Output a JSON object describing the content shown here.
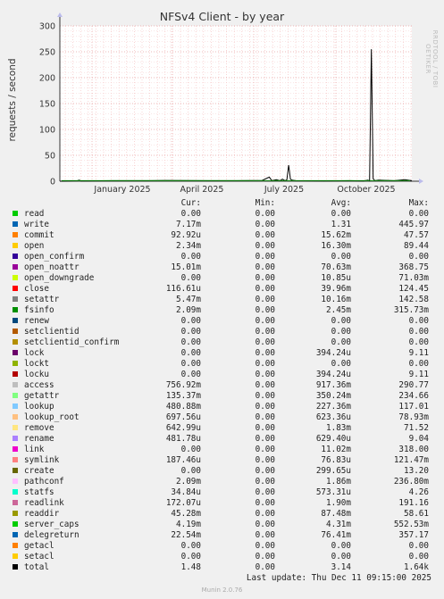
{
  "chart_data": {
    "type": "line",
    "title": "NFSv4 Client - by year",
    "ylabel": "requests / second",
    "ylim": [
      0,
      300
    ],
    "yticks": [
      "0",
      "50",
      "100",
      "150",
      "200",
      "250",
      "300"
    ],
    "xticks": [
      "January 2025",
      "April 2025",
      "July 2025",
      "October 2025"
    ],
    "grid": true,
    "series": [
      {
        "name": "total",
        "color": "#000000",
        "points": [
          [
            0,
            0
          ],
          [
            20,
            1
          ],
          [
            22,
            2
          ],
          [
            24,
            0.5
          ],
          [
            60,
            1
          ],
          [
            100,
            1
          ],
          [
            120,
            1.5
          ],
          [
            170,
            1
          ],
          [
            200,
            1
          ],
          [
            230,
            1.5
          ],
          [
            238,
            8
          ],
          [
            241,
            1
          ],
          [
            246,
            3
          ],
          [
            250,
            1
          ],
          [
            253,
            4
          ],
          [
            256,
            1
          ],
          [
            258,
            3
          ],
          [
            260,
            31
          ],
          [
            262,
            4
          ],
          [
            264,
            2
          ],
          [
            268,
            1
          ],
          [
            300,
            0.5
          ],
          [
            330,
            1
          ],
          [
            345,
            0.5
          ],
          [
            350,
            2
          ],
          [
            352,
            0.5
          ],
          [
            354,
            255
          ],
          [
            356,
            5
          ],
          [
            358,
            1
          ],
          [
            362,
            2
          ],
          [
            380,
            1
          ],
          [
            392,
            3
          ],
          [
            400,
            1
          ]
        ]
      }
    ]
  },
  "side_label": "RRDTOOL / TOBI OETIKER",
  "legend": {
    "headers": {
      "cur": "Cur:",
      "min": "Min:",
      "avg": "Avg:",
      "max": "Max:"
    },
    "rows": [
      {
        "name": "read",
        "color": "#00cc00",
        "cur": "0.00",
        "min": "0.00",
        "avg": "0.00",
        "max": "0.00"
      },
      {
        "name": "write",
        "color": "#0066b3",
        "cur": "7.17m",
        "min": "0.00",
        "avg": "1.31",
        "max": "445.97"
      },
      {
        "name": "commit",
        "color": "#ff8000",
        "cur": "92.92u",
        "min": "0.00",
        "avg": "15.62m",
        "max": "47.57"
      },
      {
        "name": "open",
        "color": "#ffcc00",
        "cur": "2.34m",
        "min": "0.00",
        "avg": "16.30m",
        "max": "89.44"
      },
      {
        "name": "open_confirm",
        "color": "#330099",
        "cur": "0.00",
        "min": "0.00",
        "avg": "0.00",
        "max": "0.00"
      },
      {
        "name": "open_noattr",
        "color": "#990099",
        "cur": "15.01m",
        "min": "0.00",
        "avg": "70.63m",
        "max": "368.75"
      },
      {
        "name": "open_downgrade",
        "color": "#ccff00",
        "cur": "0.00",
        "min": "0.00",
        "avg": "10.85u",
        "max": "71.03m"
      },
      {
        "name": "close",
        "color": "#ff0000",
        "cur": "116.61u",
        "min": "0.00",
        "avg": "39.96m",
        "max": "124.45"
      },
      {
        "name": "setattr",
        "color": "#808080",
        "cur": "5.47m",
        "min": "0.00",
        "avg": "10.16m",
        "max": "142.58"
      },
      {
        "name": "fsinfo",
        "color": "#008f00",
        "cur": "2.09m",
        "min": "0.00",
        "avg": "2.45m",
        "max": "315.73m"
      },
      {
        "name": "renew",
        "color": "#00487d",
        "cur": "0.00",
        "min": "0.00",
        "avg": "0.00",
        "max": "0.00"
      },
      {
        "name": "setclientid",
        "color": "#b35a00",
        "cur": "0.00",
        "min": "0.00",
        "avg": "0.00",
        "max": "0.00"
      },
      {
        "name": "setclientid_confirm",
        "color": "#b38f00",
        "cur": "0.00",
        "min": "0.00",
        "avg": "0.00",
        "max": "0.00"
      },
      {
        "name": "lock",
        "color": "#6b006b",
        "cur": "0.00",
        "min": "0.00",
        "avg": "394.24u",
        "max": "9.11"
      },
      {
        "name": "lockt",
        "color": "#8fb300",
        "cur": "0.00",
        "min": "0.00",
        "avg": "0.00",
        "max": "0.00"
      },
      {
        "name": "locku",
        "color": "#b30000",
        "cur": "0.00",
        "min": "0.00",
        "avg": "394.24u",
        "max": "9.11"
      },
      {
        "name": "access",
        "color": "#bebebe",
        "cur": "756.92m",
        "min": "0.00",
        "avg": "917.36m",
        "max": "290.77"
      },
      {
        "name": "getattr",
        "color": "#80ff80",
        "cur": "135.37m",
        "min": "0.00",
        "avg": "350.24m",
        "max": "234.66"
      },
      {
        "name": "lookup",
        "color": "#80c9ff",
        "cur": "480.88m",
        "min": "0.00",
        "avg": "227.36m",
        "max": "117.01"
      },
      {
        "name": "lookup_root",
        "color": "#ffc080",
        "cur": "697.56u",
        "min": "0.00",
        "avg": "623.36u",
        "max": "78.93m"
      },
      {
        "name": "remove",
        "color": "#ffe680",
        "cur": "642.99u",
        "min": "0.00",
        "avg": "1.83m",
        "max": "71.52"
      },
      {
        "name": "rename",
        "color": "#aa80ff",
        "cur": "481.78u",
        "min": "0.00",
        "avg": "629.40u",
        "max": "9.04"
      },
      {
        "name": "link",
        "color": "#ee00cc",
        "cur": "0.00",
        "min": "0.00",
        "avg": "11.02m",
        "max": "318.00"
      },
      {
        "name": "symlink",
        "color": "#ff8080",
        "cur": "187.46u",
        "min": "0.00",
        "avg": "76.83u",
        "max": "121.47m"
      },
      {
        "name": "create",
        "color": "#666600",
        "cur": "0.00",
        "min": "0.00",
        "avg": "299.65u",
        "max": "13.20"
      },
      {
        "name": "pathconf",
        "color": "#ffbfff",
        "cur": "2.09m",
        "min": "0.00",
        "avg": "1.86m",
        "max": "236.80m"
      },
      {
        "name": "statfs",
        "color": "#00ffcc",
        "cur": "34.84u",
        "min": "0.00",
        "avg": "573.31u",
        "max": "4.26"
      },
      {
        "name": "readlink",
        "color": "#cc6699",
        "cur": "172.07u",
        "min": "0.00",
        "avg": "1.90m",
        "max": "191.16"
      },
      {
        "name": "readdir",
        "color": "#999900",
        "cur": "45.28m",
        "min": "0.00",
        "avg": "87.48m",
        "max": "58.61"
      },
      {
        "name": "server_caps",
        "color": "#00cc00",
        "cur": "4.19m",
        "min": "0.00",
        "avg": "4.31m",
        "max": "552.53m"
      },
      {
        "name": "delegreturn",
        "color": "#0066b3",
        "cur": "22.54m",
        "min": "0.00",
        "avg": "76.41m",
        "max": "357.17"
      },
      {
        "name": "getacl",
        "color": "#ff8000",
        "cur": "0.00",
        "min": "0.00",
        "avg": "0.00",
        "max": "0.00"
      },
      {
        "name": "setacl",
        "color": "#ffcc00",
        "cur": "0.00",
        "min": "0.00",
        "avg": "0.00",
        "max": "0.00"
      },
      {
        "name": "total",
        "color": "#000000",
        "cur": "1.48",
        "min": "0.00",
        "avg": "3.14",
        "max": "1.64k"
      }
    ]
  },
  "last_update": "Last update: Thu Dec 11 09:15:00 2025",
  "footer": "Munin 2.0.76"
}
